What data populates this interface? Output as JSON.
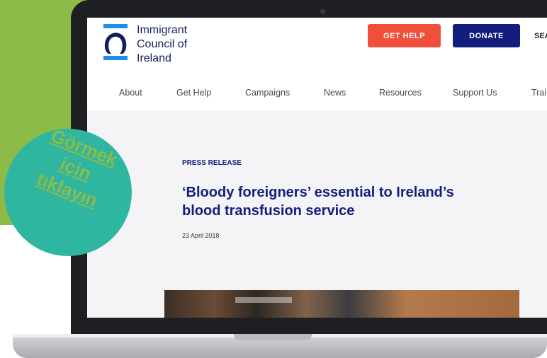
{
  "site": {
    "logo_lines": [
      "Immigrant",
      "Council of",
      "Ireland"
    ],
    "buttons": {
      "get_help": "GET HELP",
      "donate": "DONATE",
      "search": "SEA"
    },
    "nav": [
      "About",
      "Get Help",
      "Campaigns",
      "News",
      "Resources",
      "Support Us",
      "Trai"
    ]
  },
  "article": {
    "eyebrow": "PRESS RELEASE",
    "title": "‘Bloody foreigners’ essential to Ireland’s blood transfusion service",
    "date": "23 April 2018"
  },
  "badge": {
    "lines": [
      "Görmek",
      "için",
      "tıklayın"
    ]
  },
  "colors": {
    "brand_navy": "#131d7e",
    "accent_red": "#f24e3c",
    "logo_blue": "#1e8fe6",
    "background_green": "#8dbb47",
    "badge_teal": "#2fb6a1"
  },
  "icons": {
    "logo": "omega-logo-icon",
    "camera": "camera-dot-icon"
  }
}
